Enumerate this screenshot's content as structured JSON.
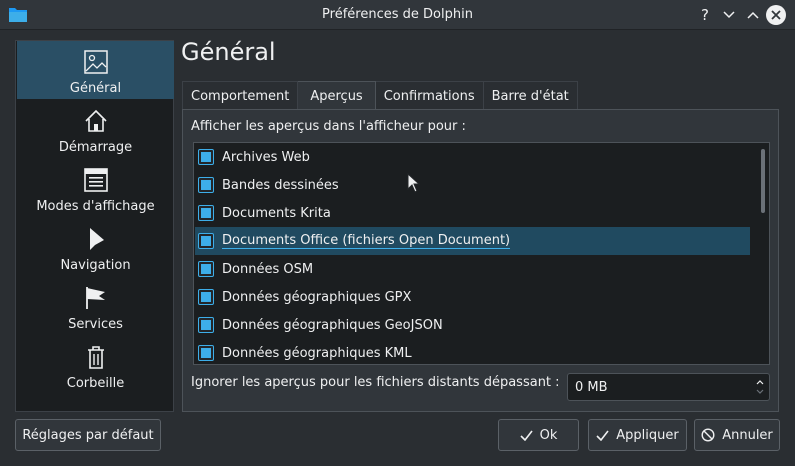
{
  "window": {
    "title": "Préférences de Dolphin",
    "controls": [
      "help",
      "minimize",
      "maximize",
      "close"
    ]
  },
  "sidebar": {
    "items": [
      {
        "label": "Général",
        "icon": "general-icon",
        "active": true
      },
      {
        "label": "Démarrage",
        "icon": "home-icon",
        "active": false
      },
      {
        "label": "Modes d'affichage",
        "icon": "view-modes-icon",
        "active": false
      },
      {
        "label": "Navigation",
        "icon": "navigation-cursor-icon",
        "active": false
      },
      {
        "label": "Services",
        "icon": "flag-icon",
        "active": false
      },
      {
        "label": "Corbeille",
        "icon": "trash-icon",
        "active": false
      }
    ]
  },
  "page": {
    "title": "Général"
  },
  "tabs": [
    {
      "label": "Comportement",
      "active": false
    },
    {
      "label": "Aperçus",
      "active": true
    },
    {
      "label": "Confirmations",
      "active": false
    },
    {
      "label": "Barre d'état",
      "active": false
    }
  ],
  "previews": {
    "heading": "Afficher les aperçus dans l'afficheur pour :",
    "items": [
      {
        "label": "Archives Web",
        "checked": true,
        "selected": false
      },
      {
        "label": "Bandes dessinées",
        "checked": true,
        "selected": false
      },
      {
        "label": "Documents Krita",
        "checked": true,
        "selected": false
      },
      {
        "label": "Documents Office (fichiers Open Document)",
        "checked": true,
        "selected": true
      },
      {
        "label": "Données OSM",
        "checked": true,
        "selected": false
      },
      {
        "label": "Données géographiques GPX",
        "checked": true,
        "selected": false
      },
      {
        "label": "Données géographiques GeoJSON",
        "checked": true,
        "selected": false
      },
      {
        "label": "Données géographiques KML",
        "checked": true,
        "selected": false
      }
    ],
    "remote_limit_label": "Ignorer les aperçus pour les fichiers distants dépassant :",
    "remote_limit_value": "0 MB"
  },
  "buttons": {
    "defaults": "Réglages par défaut",
    "ok": "Ok",
    "apply": "Appliquer",
    "cancel": "Annuler"
  },
  "colors": {
    "accent": "#3daee9",
    "selection": "#204a60",
    "window_bg": "#2a2e32"
  }
}
